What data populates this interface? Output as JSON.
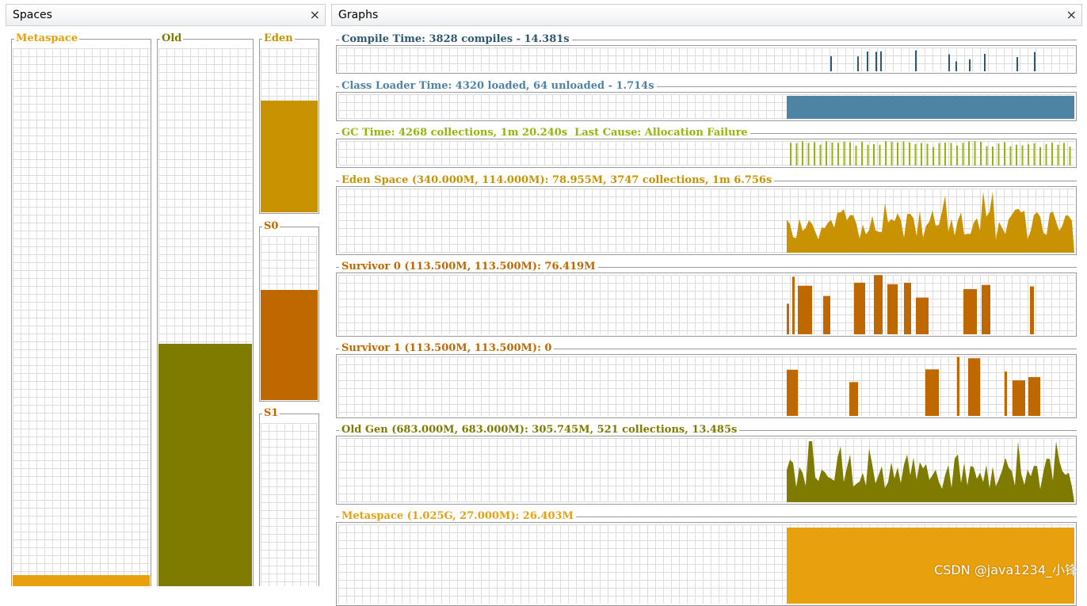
{
  "spaces_panel": {
    "title": "Spaces",
    "close_glyph": "×",
    "bars": [
      {
        "label": "Metaspace",
        "color": "#e8a00c",
        "label_color": "#e8a00c",
        "fill_fraction": 0.02
      },
      {
        "label": "Old",
        "color": "#7e7b00",
        "label_color": "#7e7b00",
        "fill_fraction": 0.45
      },
      {
        "label": "Eden",
        "color": "#c89200",
        "label_color": "#c89200",
        "fill_fraction": 0.68
      },
      {
        "label": "S0",
        "color": "#c06800",
        "label_color": "#c06800",
        "fill_fraction": 0.67
      },
      {
        "label": "S1",
        "color": "#c06800",
        "label_color": "#c06800",
        "fill_fraction": 0.0
      }
    ]
  },
  "graphs_panel": {
    "title": "Graphs",
    "close_glyph": "×",
    "graphs": [
      {
        "title": "Compile Time: 3828 compiles - 14.381s",
        "color": "#2e5872",
        "style": "spikes"
      },
      {
        "title": "Class Loader Time: 4320 loaded, 64 unloaded - 1.714s",
        "color": "#4d83a3",
        "style": "block"
      },
      {
        "title": "GC Time: 4268 collections, 1m 20.240s  Last Cause: Allocation Failure",
        "color": "#97b40a",
        "style": "comb"
      },
      {
        "title": "Eden Space (340.000M, 114.000M): 78.955M, 3747 collections, 1m 6.756s",
        "color": "#c89200",
        "style": "area"
      },
      {
        "title": "Survivor 0 (113.500M, 113.500M): 76.419M",
        "color": "#c06800",
        "style": "bars"
      },
      {
        "title": "Survivor 1 (113.500M, 113.500M): 0",
        "color": "#c06800",
        "style": "bars"
      },
      {
        "title": "Old Gen (683.000M, 683.000M): 305.745M, 521 collections, 13.485s",
        "color": "#7e7b00",
        "style": "area"
      },
      {
        "title": "Metaspace (1.025G, 27.000M): 26.403M",
        "color": "#e8a00c",
        "style": "block"
      }
    ]
  },
  "watermark": "CSDN @java1234_小锋"
}
